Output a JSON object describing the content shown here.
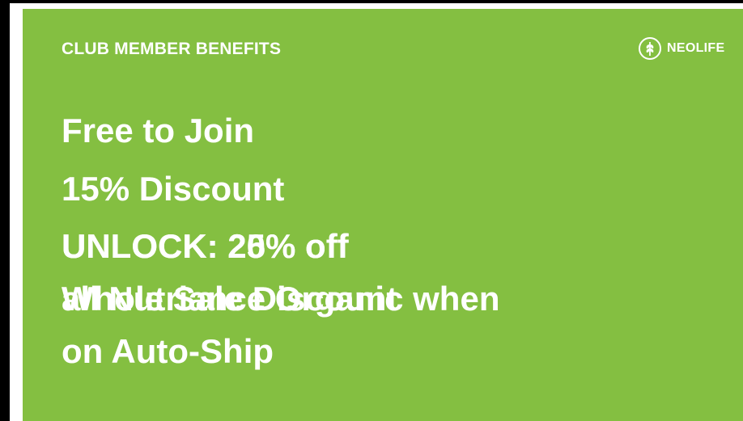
{
  "slide": {
    "header_title": "CLUB MEMBER BENEFITS",
    "brand": {
      "name": "NEOLIFE",
      "logo_icon": "leaf-circle-icon"
    },
    "colors": {
      "background": "#84bf41",
      "text": "#ffffff"
    },
    "bullets": [
      "Free to Join",
      "15% Discount",
      "UNLOCK: 20% off",
      "UNLOCK: 25% off"
    ],
    "overlapping_lines": {
      "line_a": "Whole Sale Discount",
      "line_b": "all Nutriance Organic when",
      "line_c": "on Auto-Ship"
    }
  }
}
